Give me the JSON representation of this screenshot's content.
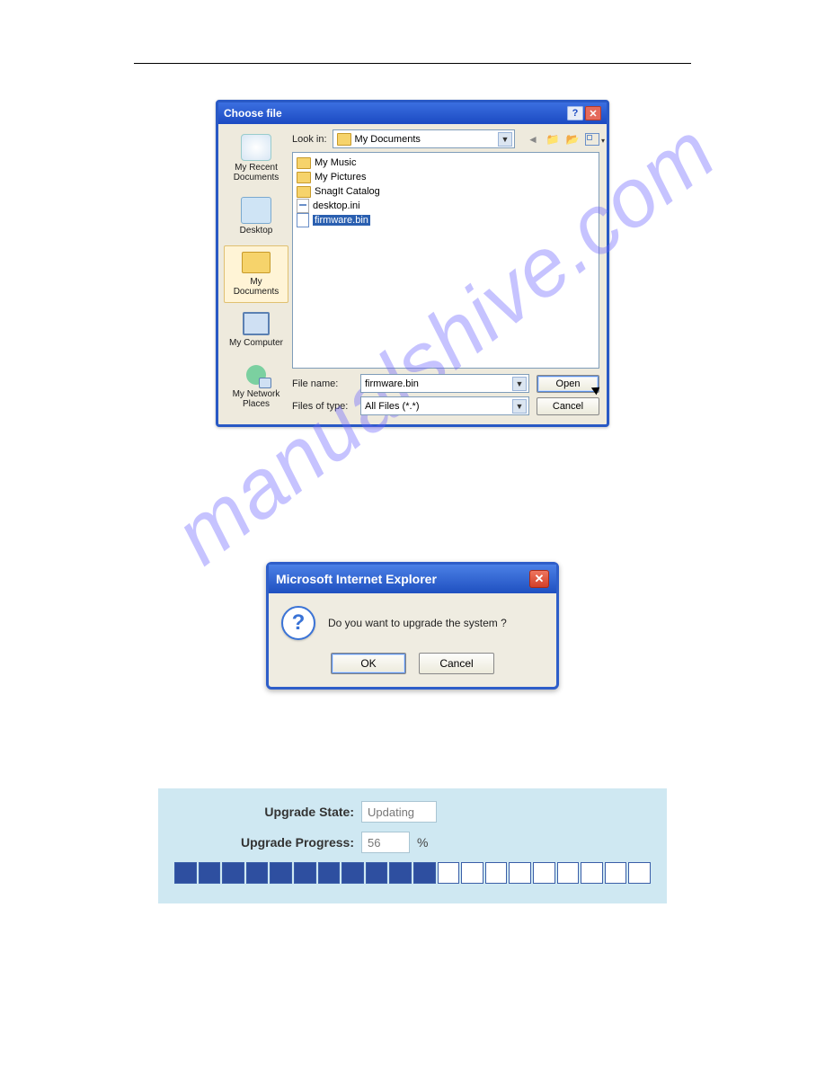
{
  "watermark": "manualshive.com",
  "chooser": {
    "title": "Choose file",
    "lookin_label": "Look in:",
    "lookin_value": "My Documents",
    "places": {
      "recent": "My Recent Documents",
      "desktop": "Desktop",
      "docs": "My Documents",
      "computer": "My Computer",
      "network": "My Network Places"
    },
    "files": {
      "my_music": "My Music",
      "my_pictures": "My Pictures",
      "snagit": "SnagIt Catalog",
      "desktop_ini": "desktop.ini",
      "firmware": "firmware.bin"
    },
    "filename_label": "File name:",
    "filename_value": "firmware.bin",
    "filetype_label": "Files of type:",
    "filetype_value": "All Files (*.*)",
    "open_btn": "Open",
    "cancel_btn": "Cancel"
  },
  "ie": {
    "title": "Microsoft Internet Explorer",
    "message": "Do you want to upgrade the system ?",
    "ok": "OK",
    "cancel": "Cancel"
  },
  "upgrade": {
    "state_label": "Upgrade State:",
    "state_value": "Updating",
    "progress_label": "Upgrade Progress:",
    "progress_value": "56",
    "progress_suffix": "%",
    "filled": 11,
    "total": 20
  }
}
